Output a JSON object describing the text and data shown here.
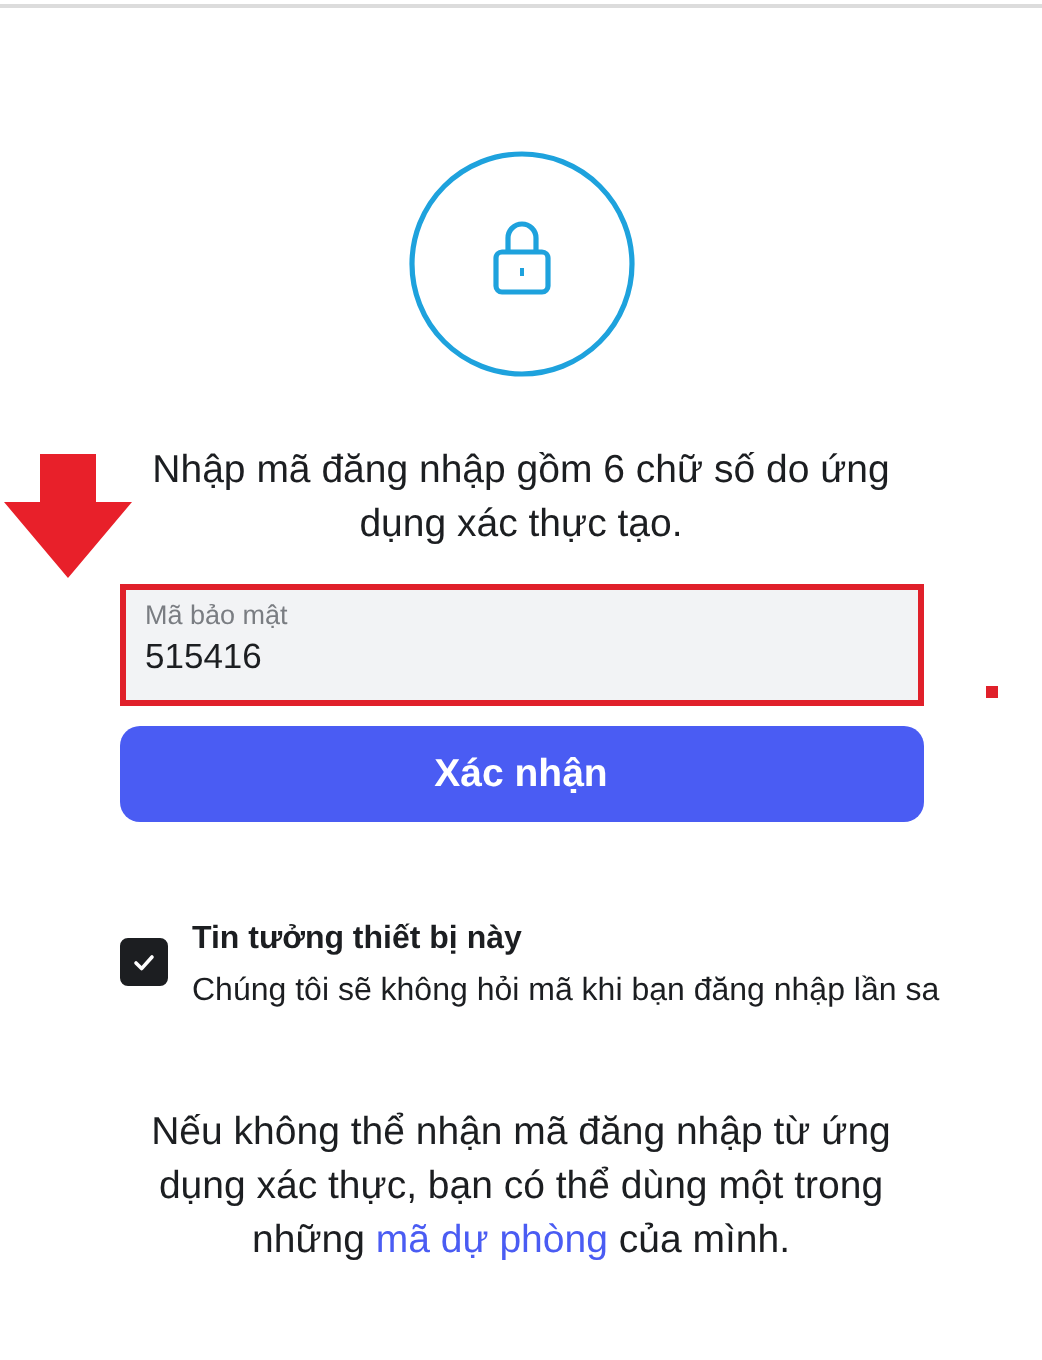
{
  "heading": "Nhập mã đăng nhập gồm 6 chữ số do ứng dụng xác thực tạo.",
  "code_field": {
    "label": "Mã bảo mật",
    "value": "515416"
  },
  "confirm_button": "Xác nhận",
  "trust_device": {
    "title": "Tin tưởng thiết bị này",
    "description": "Chúng tôi sẽ không hỏi mã khi bạn đăng nhập lần sa",
    "checked": true
  },
  "footer": {
    "before": "Nếu không thể nhận mã đăng nhập từ ứng dụng xác thực, bạn có thể dùng một trong những ",
    "link": "mã dự phòng",
    "after": " của mình."
  }
}
